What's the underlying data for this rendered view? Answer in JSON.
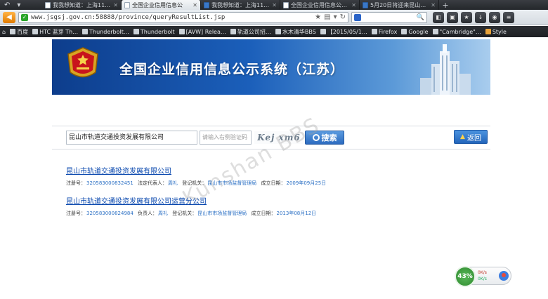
{
  "browser": {
    "tabs": [
      {
        "title": "我我想知道：上海11…",
        "active": false,
        "favicon": "doc-icon"
      },
      {
        "title": "全国企业信用信息公",
        "active": true,
        "favicon": "doc-icon"
      },
      {
        "title": "我我想知道：上海11…",
        "active": false,
        "favicon": "blue-icon"
      },
      {
        "title": "全国企业信用信息公…",
        "active": false,
        "favicon": "doc-icon"
      },
      {
        "title": "5月20日将迎来昆山…",
        "active": false,
        "favicon": "blue-icon"
      }
    ],
    "new_tab": "+",
    "url": "www.jsgsj.gov.cn:58888/province/queryResultList.jsp",
    "bookmarks": [
      "百度",
      "HTC 蓝芽 Th…",
      "Thunderbolt…",
      "Thunderbolt",
      "[AVW] Relea…",
      "轨道公司招…",
      "水木清华BBS",
      "【2015/05/1…",
      "Firefox",
      "Google",
      "\"Cambridge\"…",
      "Style"
    ]
  },
  "site": {
    "title": "全国企业信用信息公示系统（江苏）"
  },
  "search": {
    "keyword": "昆山市轨道交通投资发展有限公司",
    "captcha_placeholder": "请输入右侧验证码",
    "captcha_text": "Kej xm6",
    "search_label": "搜索",
    "return_label": "返回"
  },
  "results": [
    {
      "name": "昆山市轨道交通投资发展有限公司",
      "reg_label": "注册号：",
      "reg_no": "320583000832451",
      "rep_label": "法定代表人：",
      "rep": "周礼",
      "auth_label": "登记机关：",
      "auth": "昆山市市场监督管理局",
      "date_label": "成立日期：",
      "date": "2009年09月25日"
    },
    {
      "name": "昆山市轨道交通投资发展有限公司运营分公司",
      "reg_label": "注册号：",
      "reg_no": "320583000824984",
      "rep_label": "负责人：",
      "rep": "周礼",
      "auth_label": "登记机关：",
      "auth": "昆山市市场监督管理局",
      "date_label": "成立日期：",
      "date": "2013年08月12日"
    }
  ],
  "watermark": "Kunshan BBS",
  "widget": {
    "percent": "43%",
    "up": "0K/s",
    "down": "0K/s"
  }
}
